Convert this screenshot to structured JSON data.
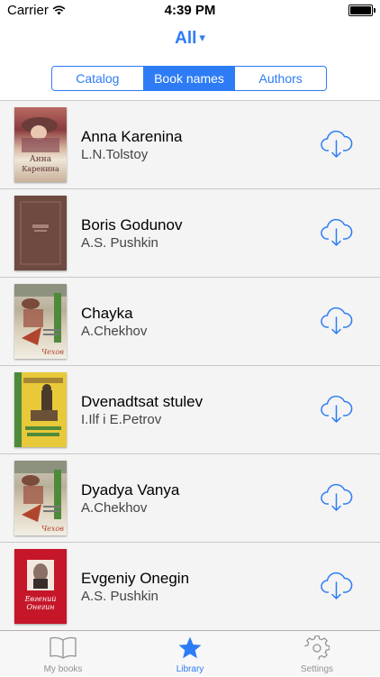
{
  "status_bar": {
    "carrier": "Carrier",
    "time": "4:39 PM"
  },
  "nav": {
    "title": "All",
    "dropdown_arrow": "▾"
  },
  "segments": [
    {
      "label": "Catalog",
      "active": false
    },
    {
      "label": "Book names",
      "active": true
    },
    {
      "label": "Authors",
      "active": false
    }
  ],
  "books": [
    {
      "title": "Anna Karenina",
      "author": "L.N.Tolstoy"
    },
    {
      "title": "Boris Godunov",
      "author": "A.S. Pushkin"
    },
    {
      "title": "Chayka",
      "author": "A.Chekhov"
    },
    {
      "title": "Dvenadtsat stulev",
      "author": "I.Ilf i E.Petrov"
    },
    {
      "title": "Dyadya Vanya",
      "author": "A.Chekhov"
    },
    {
      "title": "Evgeniy Onegin",
      "author": "A.S. Pushkin"
    }
  ],
  "tabbar": {
    "tabs": [
      {
        "label": "My books",
        "icon": "book-icon",
        "active": false
      },
      {
        "label": "Library",
        "icon": "star-icon",
        "active": true
      },
      {
        "label": "Settings",
        "icon": "gear-icon",
        "active": false
      }
    ]
  },
  "colors": {
    "accent": "#2d7cf6",
    "list_bg": "#f4f4f4",
    "tab_inactive": "#929292"
  }
}
